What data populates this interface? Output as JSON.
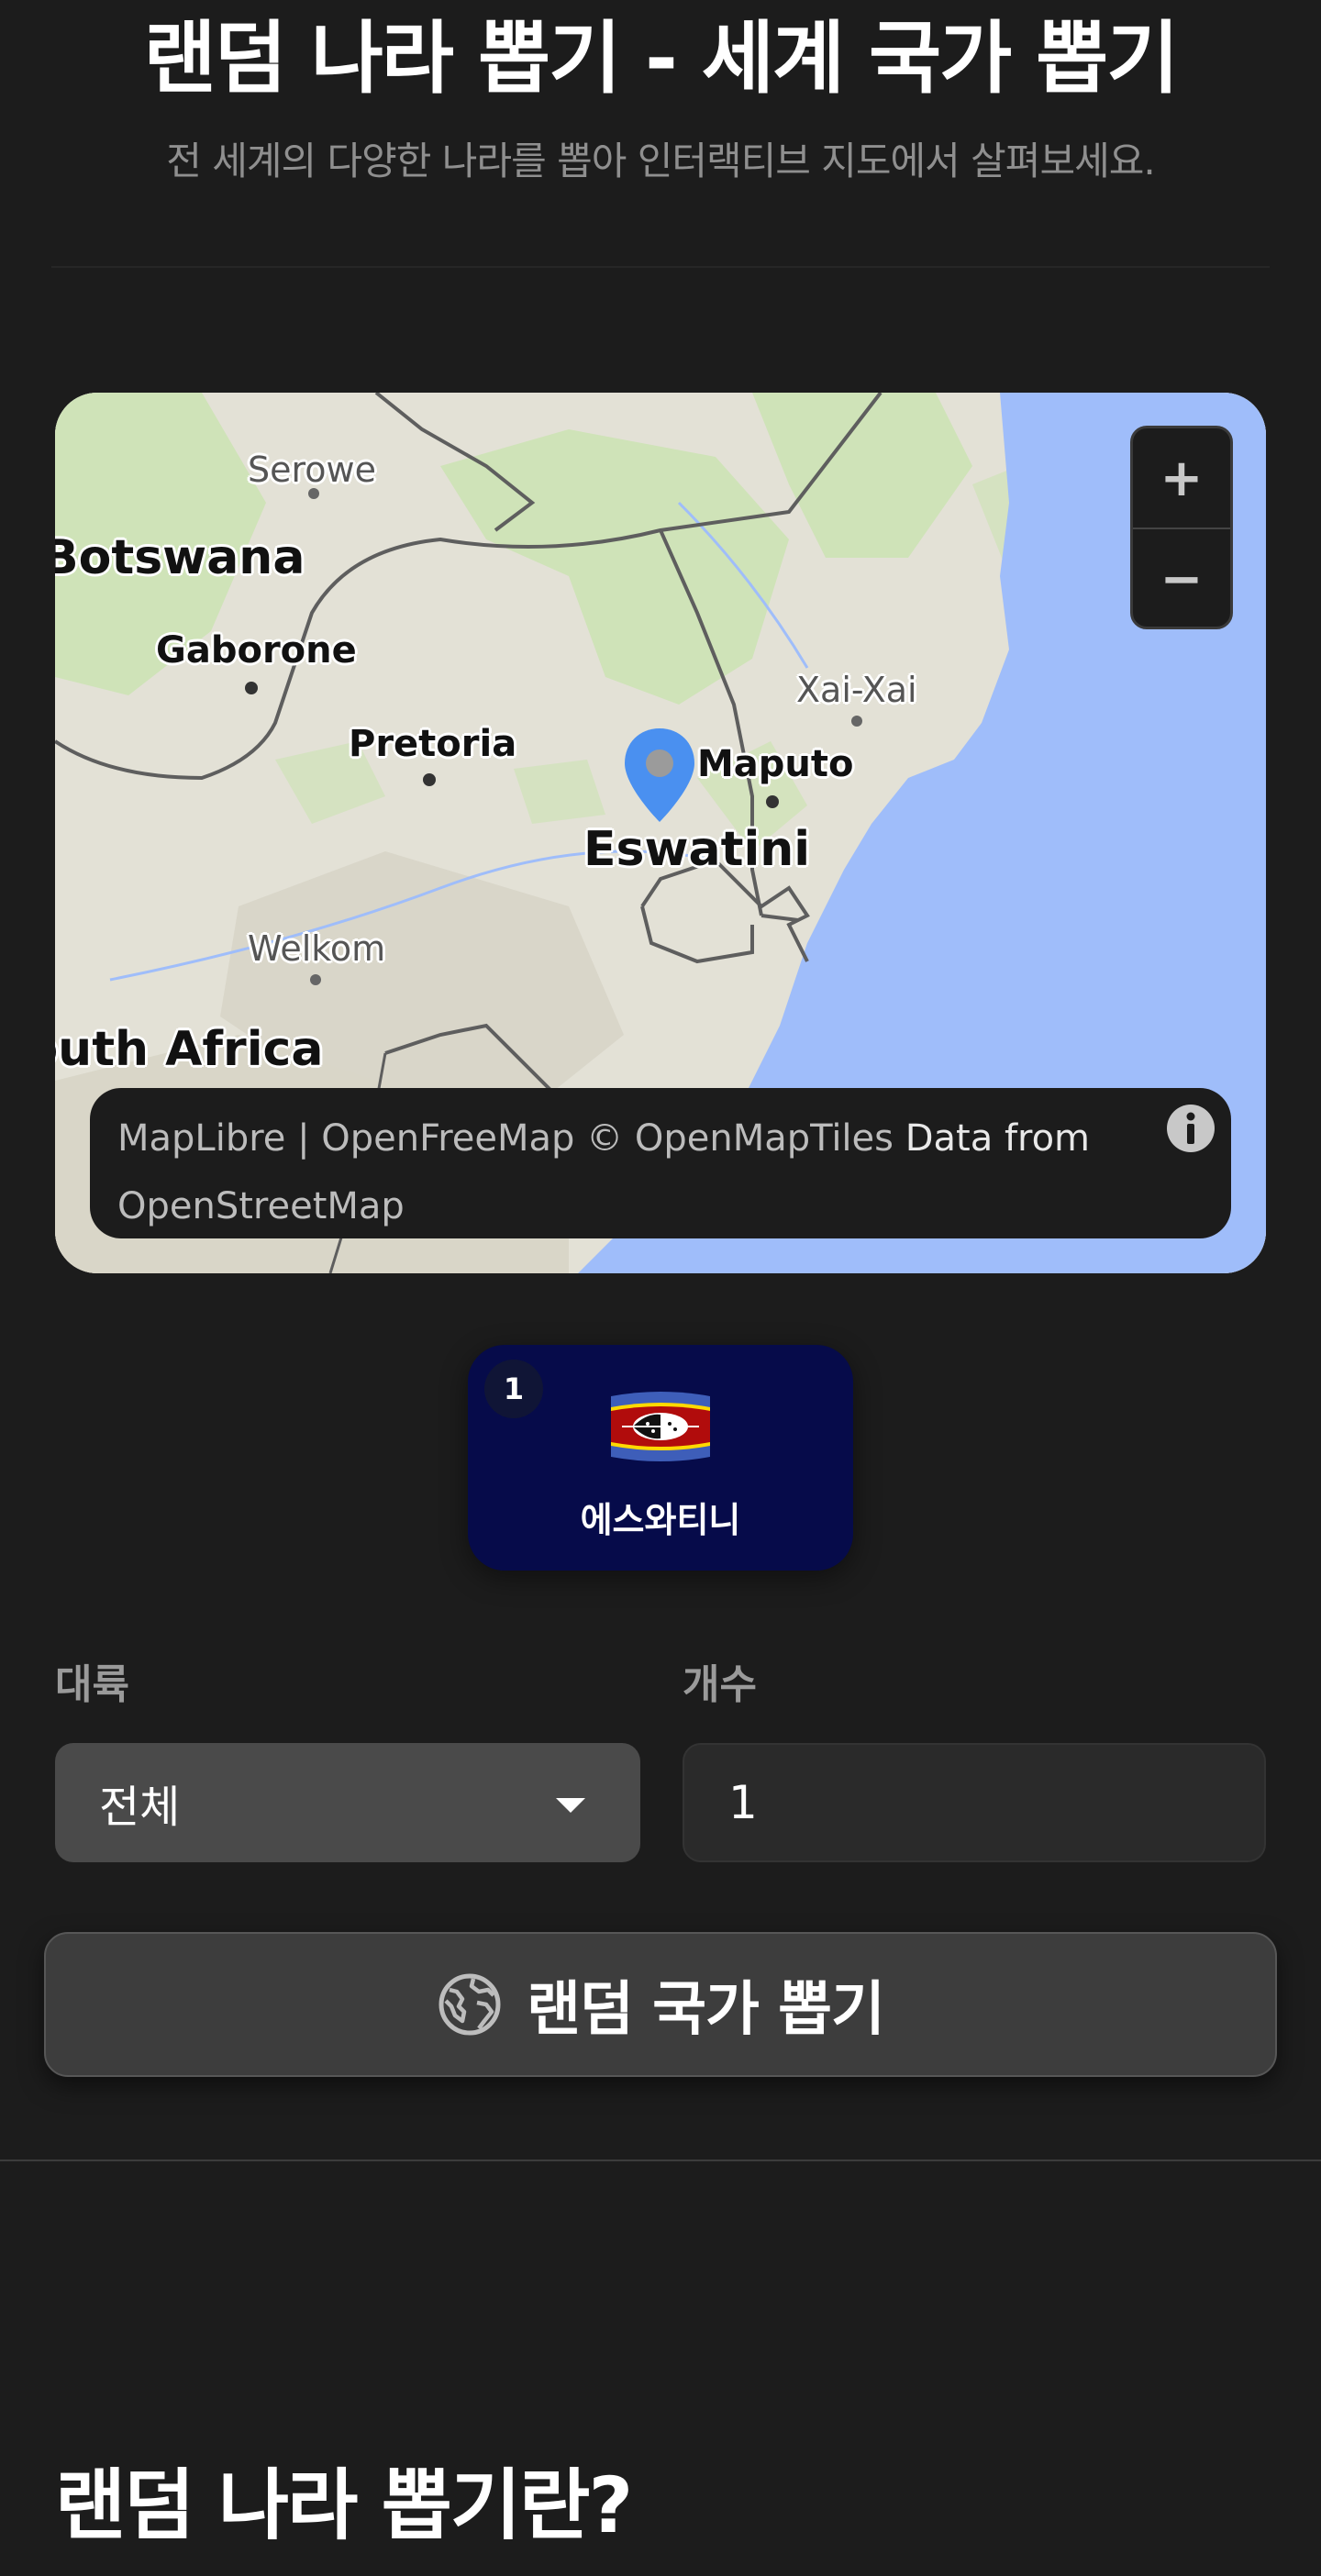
{
  "header": {
    "title": "랜덤 나라 뽑기 - 세계 국가 뽑기",
    "subtitle": "전 세계의 다양한 나라를 뽑아 인터랙티브 지도에서 살펴보세요."
  },
  "map": {
    "labels": {
      "botswana": "Botswana",
      "serowe": "Serowe",
      "gaborone": "Gaborone",
      "pretoria": "Pretoria",
      "xai_xai": "Xai-Xai",
      "maputo": "Maputo",
      "eswatini": "Eswatini",
      "welkom": "Welkom",
      "south_africa": "South Africa"
    },
    "zoom_in_label": "+",
    "zoom_out_label": "−",
    "attribution": {
      "maplibre": "MapLibre",
      "separator": " | ",
      "openfreemap": "OpenFreeMap",
      "openmaptiles": " © OpenMapTiles",
      "data_from": " Data from ",
      "osm": "OpenStreetMap"
    },
    "info_icon": "info-icon",
    "marker_icon": "map-pin-icon"
  },
  "result": {
    "index": "1",
    "flag_icon": "eswatini-flag-icon",
    "name": "에스와티니"
  },
  "filters": {
    "continent_label": "대륙",
    "continent_value": "전체",
    "count_label": "개수",
    "count_value": "1"
  },
  "action": {
    "pick_button_label": "랜덤 국가 뽑기",
    "icon": "globe-icon"
  },
  "section": {
    "heading": "랜덤 나라 뽑기란?"
  },
  "colors": {
    "background": "#1c1c1c",
    "ocean": "#9fbdfa",
    "land": "#e3e1d6",
    "forest": "#cfe3b8",
    "result_card": "#060b4a",
    "marker": "#4a90f0",
    "select_bg": "#4a4a4a",
    "button_bg": "#3d3d3d"
  }
}
